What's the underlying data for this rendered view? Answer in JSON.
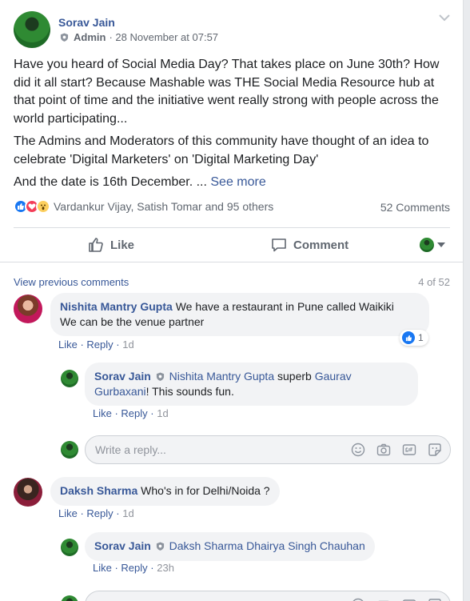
{
  "post": {
    "author": "Sorav Jain",
    "role": "Admin",
    "timestamp": "· 28 November at 07:57",
    "paragraphs": [
      "Have you heard of Social Media Day? That takes place on June 30th? How did it all start? Because Mashable was THE Social Media Resource hub at that point of time and the initiative went really strong with people across the world participating...",
      "The Admins and Moderators of this community have thought of an idea to celebrate 'Digital Marketers' on 'Digital Marketing Day'"
    ],
    "last_line": "And the date is 16th December. ...",
    "see_more": "See more",
    "reactions_names": "Vardankur Vijay, Satish Tomar and 95 others",
    "comments_count": "52 Comments",
    "reaction_icons": [
      "like-reaction",
      "love-reaction",
      "wow-reaction"
    ]
  },
  "actions": {
    "like": "Like",
    "comment": "Comment"
  },
  "comments_section": {
    "view_previous": "View previous comments",
    "page_count": "4 of 52",
    "reply_placeholder": "Write a reply...",
    "threads": [
      {
        "author": "Nishita Mantry Gupta",
        "text_line1": "We have a restaurant in Pune called Waikiki",
        "text_line2": "We can be the venue partner",
        "like": "Like",
        "reply": "Reply",
        "time": "1d",
        "reaction_count": "1",
        "reply_item": {
          "author": "Sorav Jain",
          "tag1": "Nishita Mantry Gupta",
          "mid": "superb",
          "tag2_line1": "Gaurav",
          "tag2_line2": "Gurbaxani",
          "rest": "! This sounds fun.",
          "like": "Like",
          "reply": "Reply",
          "time": "1d"
        }
      },
      {
        "author": "Daksh Sharma",
        "text": "Who's in for Delhi/Noida ?",
        "like": "Like",
        "reply": "Reply",
        "time": "1d",
        "reply_item": {
          "author": "Sorav Jain",
          "tags": "Daksh Sharma Dhairya Singh Chauhan",
          "like": "Like",
          "reply": "Reply",
          "time": "23h"
        }
      }
    ]
  },
  "colors": {
    "link": "#385898",
    "muted": "#606770",
    "bubble": "#f2f3f5",
    "like_blue": "#1877f2"
  }
}
